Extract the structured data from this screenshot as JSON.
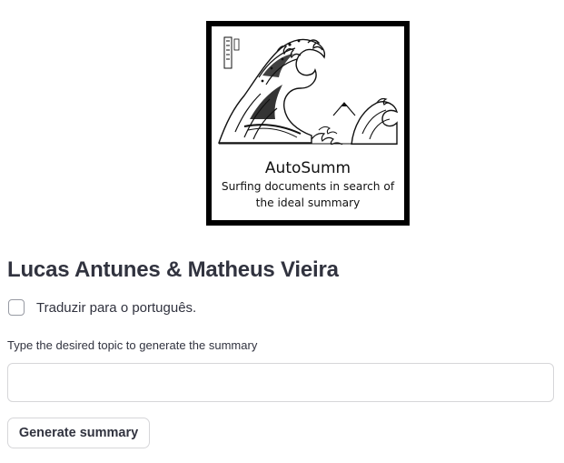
{
  "logo": {
    "title": "AutoSumm",
    "tagline_line1": "Surfing documents in search of",
    "tagline_line2": "the ideal summary",
    "image_icon": "great-wave-illustration"
  },
  "heading": "Lucas Antunes & Matheus Vieira",
  "translate_checkbox": {
    "label": "Traduzir para o português.",
    "checked": false
  },
  "topic_input": {
    "label": "Type the desired topic to generate the summary",
    "value": "",
    "placeholder": ""
  },
  "generate_button": {
    "label": "Generate summary"
  },
  "colors": {
    "text": "#31333f",
    "border": "#d6d6d9",
    "logo_frame": "#000000"
  }
}
